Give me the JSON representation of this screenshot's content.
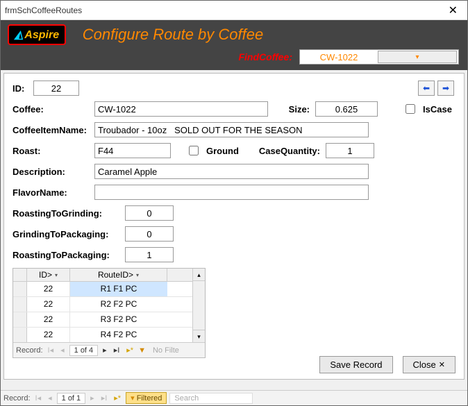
{
  "window": {
    "title": "frmSchCoffeeRoutes"
  },
  "header": {
    "logo_text": "Aspire",
    "title": "Configure Route by Coffee",
    "find_label": "FindCoffee:",
    "find_value": "CW-1022"
  },
  "labels": {
    "id": "ID:",
    "coffee": "Coffee:",
    "size": "Size:",
    "iscase": "IsCase",
    "coffee_item_name": "CoffeeItemName:",
    "roast": "Roast:",
    "ground": "Ground",
    "case_quantity": "CaseQuantity:",
    "description": "Description:",
    "flavor_name": "FlavorName:",
    "roasting_to_grinding": "RoastingToGrinding:",
    "grinding_to_packaging": "GrindingToPackaging:",
    "roasting_to_packaging": "RoastingToPackaging:"
  },
  "values": {
    "id": "22",
    "coffee": "CW-1022",
    "size": "0.625",
    "coffee_item_name": "Troubador - 10oz   SOLD OUT FOR THE SEASON",
    "roast": "F44",
    "case_quantity": "1",
    "description": "Caramel Apple",
    "flavor_name": "",
    "roasting_to_grinding": "0",
    "grinding_to_packaging": "0",
    "roasting_to_packaging": "1",
    "iscase_checked": false,
    "ground_checked": false
  },
  "subform": {
    "col_id": "ID>",
    "col_route": "RouteID>",
    "rows": [
      {
        "id": "22",
        "route": "R1 F1 PC",
        "selected": true
      },
      {
        "id": "22",
        "route": "R2 F2 PC",
        "selected": false
      },
      {
        "id": "22",
        "route": "R3 F2 PC",
        "selected": false
      },
      {
        "id": "22",
        "route": "R4 F2 PC",
        "selected": false
      }
    ],
    "recnav": {
      "label": "Record:",
      "counter": "1 of 4",
      "nofilter": "No Filte"
    }
  },
  "buttons": {
    "save": "Save Record",
    "close": "Close"
  },
  "outer_recnav": {
    "label": "Record:",
    "counter": "1 of 1",
    "filtered": "Filtered",
    "search_placeholder": "Search"
  }
}
